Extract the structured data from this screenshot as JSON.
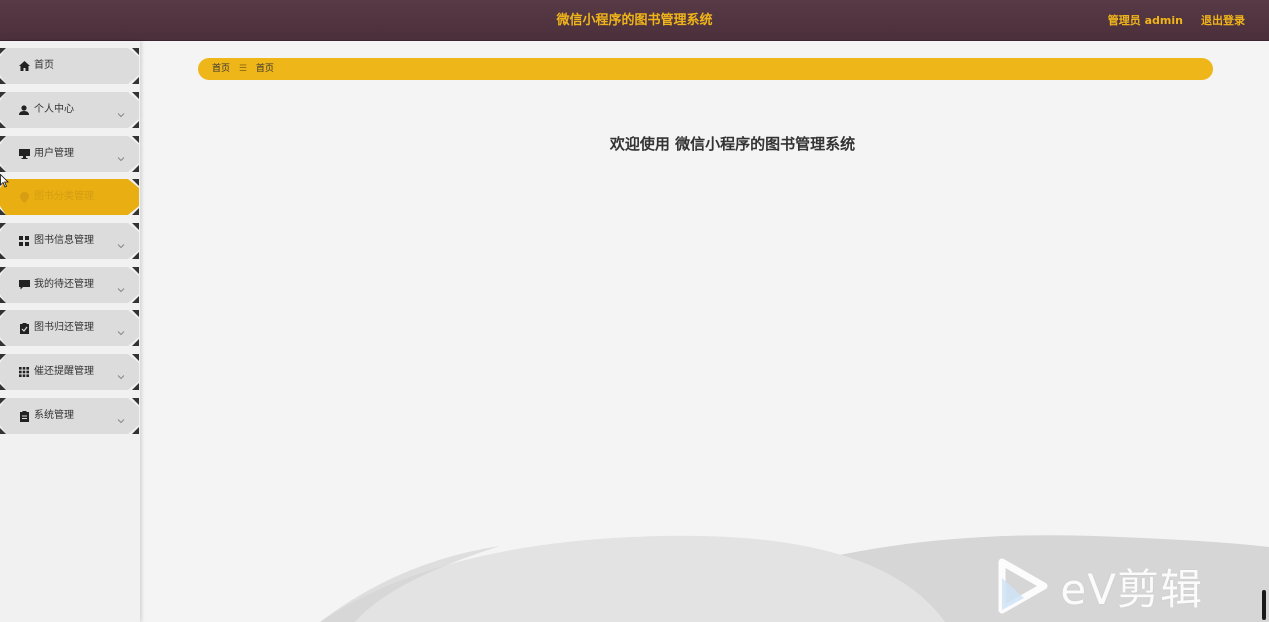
{
  "header": {
    "title": "微信小程序的图书管理系统",
    "user": "管理员 admin",
    "logout": "退出登录"
  },
  "sidebar": {
    "items": [
      {
        "label": "首页",
        "icon": "home-icon",
        "has_caret": false,
        "active": false
      },
      {
        "label": "个人中心",
        "icon": "user-icon",
        "has_caret": true,
        "active": false
      },
      {
        "label": "用户管理",
        "icon": "monitor-icon",
        "has_caret": true,
        "active": false
      },
      {
        "label": "图书分类管理",
        "icon": "pin-icon",
        "has_caret": false,
        "active": true
      },
      {
        "label": "图书信息管理",
        "icon": "grid-icon",
        "has_caret": true,
        "active": false
      },
      {
        "label": "我的待还管理",
        "icon": "comment-icon",
        "has_caret": true,
        "active": false
      },
      {
        "label": "图书归还管理",
        "icon": "clipboard-check-icon",
        "has_caret": true,
        "active": false
      },
      {
        "label": "催还提醒管理",
        "icon": "apps-icon",
        "has_caret": true,
        "active": false
      },
      {
        "label": "系统管理",
        "icon": "clipboard-icon",
        "has_caret": true,
        "active": false
      }
    ]
  },
  "breadcrumb": {
    "items": [
      "首页",
      "首页"
    ],
    "separator": "☰"
  },
  "main": {
    "welcome": "欢迎使用 微信小程序的图书管理系统"
  },
  "watermark": {
    "text": "eV剪辑"
  },
  "colors": {
    "header_bg": "#573a45",
    "accent": "#efb61a",
    "menu_bg": "#dcdcdc",
    "active_bg": "#e8ae12"
  }
}
